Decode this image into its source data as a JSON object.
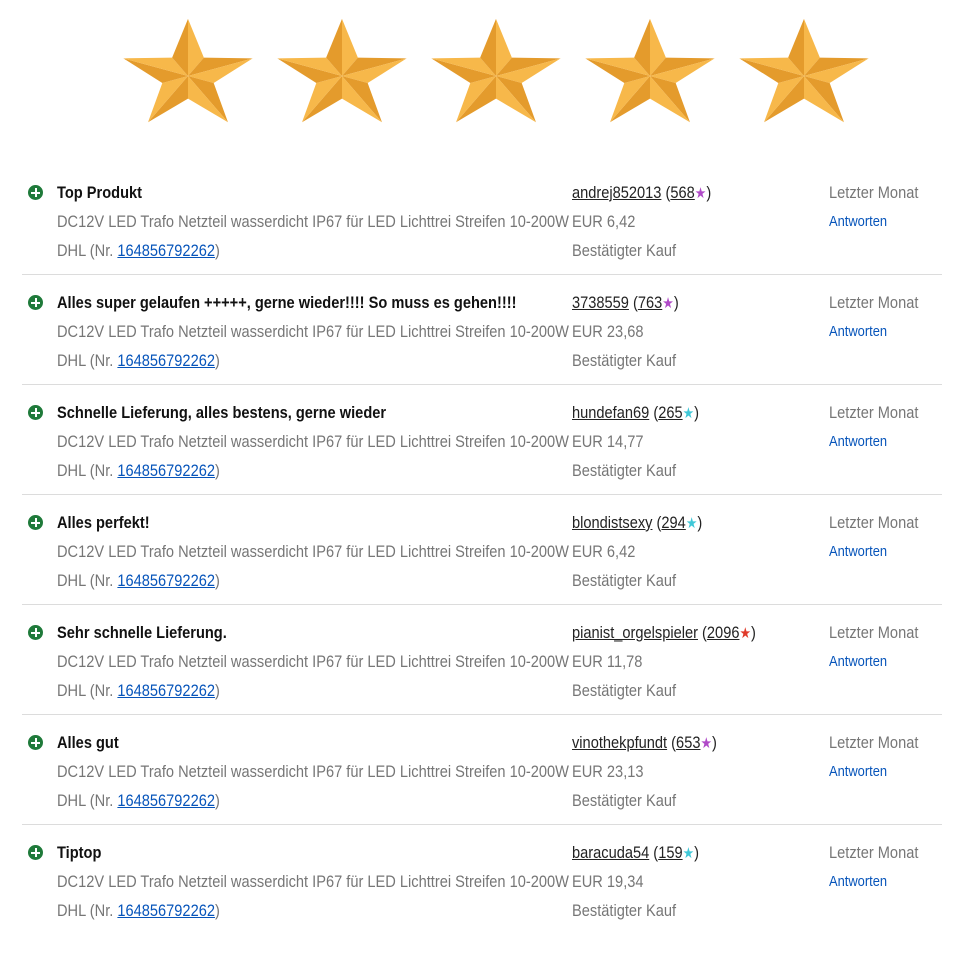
{
  "rating": {
    "stars": 5,
    "max": 5,
    "color": "#f0a830"
  },
  "colors": {
    "link": "#0654ba",
    "muted": "#767676",
    "positive": "#1f7a3a",
    "star_purple": "#b04ac8",
    "star_teal": "#3fc8d8",
    "star_red": "#e03a2a"
  },
  "reviews": [
    {
      "title": "Top Produkt",
      "item": "DC12V LED Trafo Netzteil wasserdicht IP67 für LED Lichttrei Streifen 10-200W",
      "order_prefix": "DHL (Nr. ",
      "order_no": "164856792262",
      "order_suffix": ")",
      "user": "andrej852013",
      "score": "568",
      "star": "★",
      "star_color": "#b04ac8",
      "price": "EUR 6,42",
      "verified": "Bestätigter Kauf",
      "when": "Letzter Monat",
      "reply": "Antworten",
      "icon": "plus-circle-icon"
    },
    {
      "title": "Alles super gelaufen +++++, gerne wieder!!!! So muss es gehen!!!!",
      "item": "DC12V LED Trafo Netzteil wasserdicht IP67 für LED Lichttrei Streifen 10-200W",
      "order_prefix": "DHL (Nr. ",
      "order_no": "164856792262",
      "order_suffix": ")",
      "user": "3738559",
      "score": "763",
      "star": "★",
      "star_color": "#b04ac8",
      "price": "EUR 23,68",
      "verified": "Bestätigter Kauf",
      "when": "Letzter Monat",
      "reply": "Antworten",
      "icon": "plus-circle-icon"
    },
    {
      "title": "Schnelle Lieferung, alles bestens, gerne wieder",
      "item": "DC12V LED Trafo Netzteil wasserdicht IP67 für LED Lichttrei Streifen 10-200W",
      "order_prefix": "DHL (Nr. ",
      "order_no": "164856792262",
      "order_suffix": ")",
      "user": "hundefan69",
      "score": "265",
      "star": "★",
      "star_color": "#3fc8d8",
      "price": "EUR 14,77",
      "verified": "Bestätigter Kauf",
      "when": "Letzter Monat",
      "reply": "Antworten",
      "icon": "plus-circle-icon"
    },
    {
      "title": "Alles perfekt!",
      "item": "DC12V LED Trafo Netzteil wasserdicht IP67 für LED Lichttrei Streifen 10-200W",
      "order_prefix": "DHL (Nr. ",
      "order_no": "164856792262",
      "order_suffix": ")",
      "user": "blondistsexy",
      "score": "294",
      "star": "★",
      "star_color": "#3fc8d8",
      "price": "EUR 6,42",
      "verified": "Bestätigter Kauf",
      "when": "Letzter Monat",
      "reply": "Antworten",
      "icon": "plus-circle-icon"
    },
    {
      "title": "Sehr schnelle Lieferung.",
      "item": "DC12V LED Trafo Netzteil wasserdicht IP67 für LED Lichttrei Streifen 10-200W",
      "order_prefix": "DHL (Nr. ",
      "order_no": "164856792262",
      "order_suffix": ")",
      "user": "pianist_orgelspieler",
      "score": "2096",
      "star": "★",
      "star_color": "#e03a2a",
      "price": "EUR 11,78",
      "verified": "Bestätigter Kauf",
      "when": "Letzter Monat",
      "reply": "Antworten",
      "icon": "plus-circle-icon"
    },
    {
      "title": "Alles gut",
      "item": "DC12V LED Trafo Netzteil wasserdicht IP67 für LED Lichttrei Streifen 10-200W",
      "order_prefix": "DHL (Nr. ",
      "order_no": "164856792262",
      "order_suffix": ")",
      "user": "vinothekpfundt",
      "score": "653",
      "star": "★",
      "star_color": "#b04ac8",
      "price": "EUR 23,13",
      "verified": "Bestätigter Kauf",
      "when": "Letzter Monat",
      "reply": "Antworten",
      "icon": "plus-circle-icon"
    },
    {
      "title": "Tiptop",
      "item": "DC12V LED Trafo Netzteil wasserdicht IP67 für LED Lichttrei Streifen 10-200W",
      "order_prefix": "DHL (Nr. ",
      "order_no": "164856792262",
      "order_suffix": ")",
      "user": "baracuda54",
      "score": "159",
      "star": "★",
      "star_color": "#3fc8d8",
      "price": "EUR 19,34",
      "verified": "Bestätigter Kauf",
      "when": "Letzter Monat",
      "reply": "Antworten",
      "icon": "plus-circle-icon"
    }
  ]
}
